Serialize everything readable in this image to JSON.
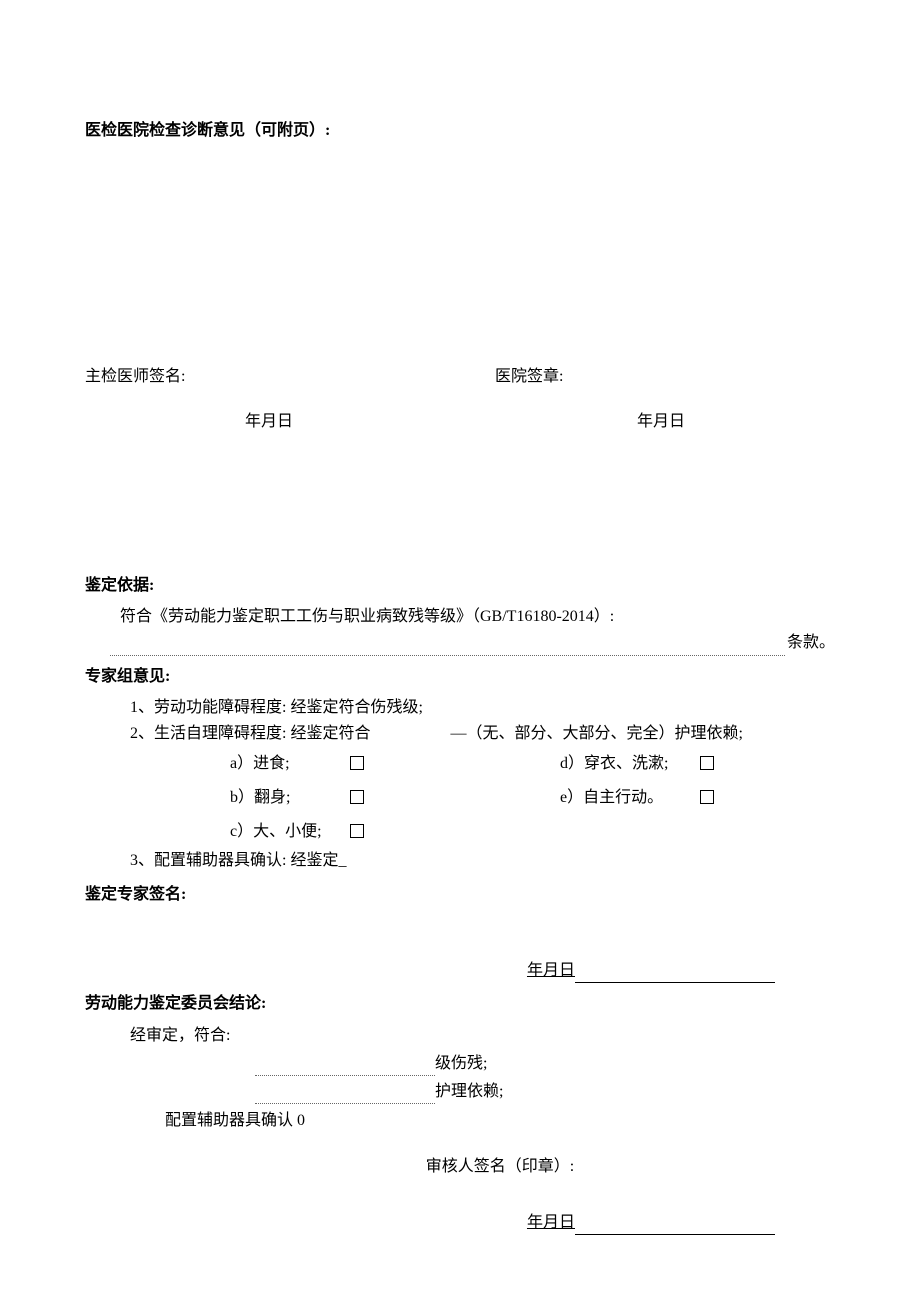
{
  "top_section": {
    "title": "医检医院检查诊断意见（可附页）:",
    "examiner_sign": "主检医师签名:",
    "hospital_seal": "医院签章:",
    "date1": "年月日",
    "date2": "年月日"
  },
  "basis": {
    "title": "鉴定依据:",
    "line": "符合《劳动能力鉴定职工工伤与职业病致残等级》（GB/T16180-2014）:",
    "suffix": "条款。"
  },
  "expert": {
    "title": "专家组意见:",
    "item1": "1、劳动功能障碍程度: 经鉴定符合伤残级;",
    "item2_prefix": "2、生活自理障碍程度: 经鉴定符合",
    "item2_suffix": "—（无、部分、大部分、完全）护理依赖;",
    "a": "a）进食;",
    "b": "b）翻身;",
    "c": "c）大、小便;",
    "d": "d）穿衣、洗漱;",
    "e": "e）自主行动。",
    "item3": "3、配置辅助器具确认: 经鉴定_"
  },
  "expert_sign": {
    "title": "鉴定专家签名:",
    "date": "年月日"
  },
  "committee": {
    "title": "劳动能力鉴定委员会结论:",
    "approved": "经审定，符合:",
    "c1": "级伤残;",
    "c2": "护理依赖;",
    "c3": "配置辅助器具确认 0",
    "reviewer": "审核人签名（印章）:",
    "date": "年月日"
  }
}
